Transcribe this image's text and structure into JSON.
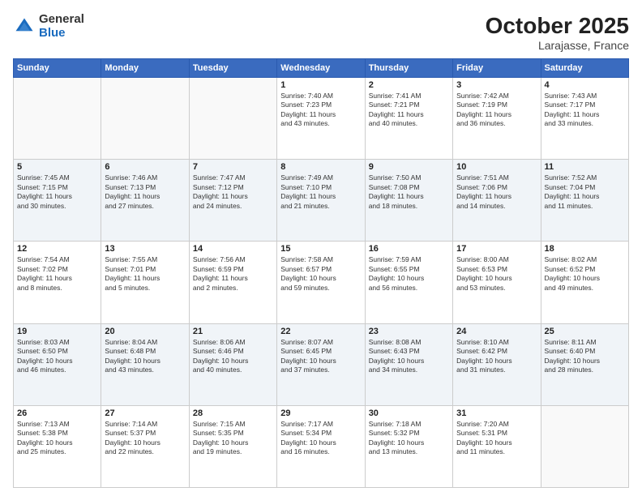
{
  "header": {
    "logo": {
      "general": "General",
      "blue": "Blue"
    },
    "title": "October 2025",
    "location": "Larajasse, France"
  },
  "weekdays": [
    "Sunday",
    "Monday",
    "Tuesday",
    "Wednesday",
    "Thursday",
    "Friday",
    "Saturday"
  ],
  "weeks": [
    [
      {
        "day": "",
        "content": ""
      },
      {
        "day": "",
        "content": ""
      },
      {
        "day": "",
        "content": ""
      },
      {
        "day": "1",
        "content": "Sunrise: 7:40 AM\nSunset: 7:23 PM\nDaylight: 11 hours\nand 43 minutes."
      },
      {
        "day": "2",
        "content": "Sunrise: 7:41 AM\nSunset: 7:21 PM\nDaylight: 11 hours\nand 40 minutes."
      },
      {
        "day": "3",
        "content": "Sunrise: 7:42 AM\nSunset: 7:19 PM\nDaylight: 11 hours\nand 36 minutes."
      },
      {
        "day": "4",
        "content": "Sunrise: 7:43 AM\nSunset: 7:17 PM\nDaylight: 11 hours\nand 33 minutes."
      }
    ],
    [
      {
        "day": "5",
        "content": "Sunrise: 7:45 AM\nSunset: 7:15 PM\nDaylight: 11 hours\nand 30 minutes."
      },
      {
        "day": "6",
        "content": "Sunrise: 7:46 AM\nSunset: 7:13 PM\nDaylight: 11 hours\nand 27 minutes."
      },
      {
        "day": "7",
        "content": "Sunrise: 7:47 AM\nSunset: 7:12 PM\nDaylight: 11 hours\nand 24 minutes."
      },
      {
        "day": "8",
        "content": "Sunrise: 7:49 AM\nSunset: 7:10 PM\nDaylight: 11 hours\nand 21 minutes."
      },
      {
        "day": "9",
        "content": "Sunrise: 7:50 AM\nSunset: 7:08 PM\nDaylight: 11 hours\nand 18 minutes."
      },
      {
        "day": "10",
        "content": "Sunrise: 7:51 AM\nSunset: 7:06 PM\nDaylight: 11 hours\nand 14 minutes."
      },
      {
        "day": "11",
        "content": "Sunrise: 7:52 AM\nSunset: 7:04 PM\nDaylight: 11 hours\nand 11 minutes."
      }
    ],
    [
      {
        "day": "12",
        "content": "Sunrise: 7:54 AM\nSunset: 7:02 PM\nDaylight: 11 hours\nand 8 minutes."
      },
      {
        "day": "13",
        "content": "Sunrise: 7:55 AM\nSunset: 7:01 PM\nDaylight: 11 hours\nand 5 minutes."
      },
      {
        "day": "14",
        "content": "Sunrise: 7:56 AM\nSunset: 6:59 PM\nDaylight: 11 hours\nand 2 minutes."
      },
      {
        "day": "15",
        "content": "Sunrise: 7:58 AM\nSunset: 6:57 PM\nDaylight: 10 hours\nand 59 minutes."
      },
      {
        "day": "16",
        "content": "Sunrise: 7:59 AM\nSunset: 6:55 PM\nDaylight: 10 hours\nand 56 minutes."
      },
      {
        "day": "17",
        "content": "Sunrise: 8:00 AM\nSunset: 6:53 PM\nDaylight: 10 hours\nand 53 minutes."
      },
      {
        "day": "18",
        "content": "Sunrise: 8:02 AM\nSunset: 6:52 PM\nDaylight: 10 hours\nand 49 minutes."
      }
    ],
    [
      {
        "day": "19",
        "content": "Sunrise: 8:03 AM\nSunset: 6:50 PM\nDaylight: 10 hours\nand 46 minutes."
      },
      {
        "day": "20",
        "content": "Sunrise: 8:04 AM\nSunset: 6:48 PM\nDaylight: 10 hours\nand 43 minutes."
      },
      {
        "day": "21",
        "content": "Sunrise: 8:06 AM\nSunset: 6:46 PM\nDaylight: 10 hours\nand 40 minutes."
      },
      {
        "day": "22",
        "content": "Sunrise: 8:07 AM\nSunset: 6:45 PM\nDaylight: 10 hours\nand 37 minutes."
      },
      {
        "day": "23",
        "content": "Sunrise: 8:08 AM\nSunset: 6:43 PM\nDaylight: 10 hours\nand 34 minutes."
      },
      {
        "day": "24",
        "content": "Sunrise: 8:10 AM\nSunset: 6:42 PM\nDaylight: 10 hours\nand 31 minutes."
      },
      {
        "day": "25",
        "content": "Sunrise: 8:11 AM\nSunset: 6:40 PM\nDaylight: 10 hours\nand 28 minutes."
      }
    ],
    [
      {
        "day": "26",
        "content": "Sunrise: 7:13 AM\nSunset: 5:38 PM\nDaylight: 10 hours\nand 25 minutes."
      },
      {
        "day": "27",
        "content": "Sunrise: 7:14 AM\nSunset: 5:37 PM\nDaylight: 10 hours\nand 22 minutes."
      },
      {
        "day": "28",
        "content": "Sunrise: 7:15 AM\nSunset: 5:35 PM\nDaylight: 10 hours\nand 19 minutes."
      },
      {
        "day": "29",
        "content": "Sunrise: 7:17 AM\nSunset: 5:34 PM\nDaylight: 10 hours\nand 16 minutes."
      },
      {
        "day": "30",
        "content": "Sunrise: 7:18 AM\nSunset: 5:32 PM\nDaylight: 10 hours\nand 13 minutes."
      },
      {
        "day": "31",
        "content": "Sunrise: 7:20 AM\nSunset: 5:31 PM\nDaylight: 10 hours\nand 11 minutes."
      },
      {
        "day": "",
        "content": ""
      }
    ]
  ]
}
